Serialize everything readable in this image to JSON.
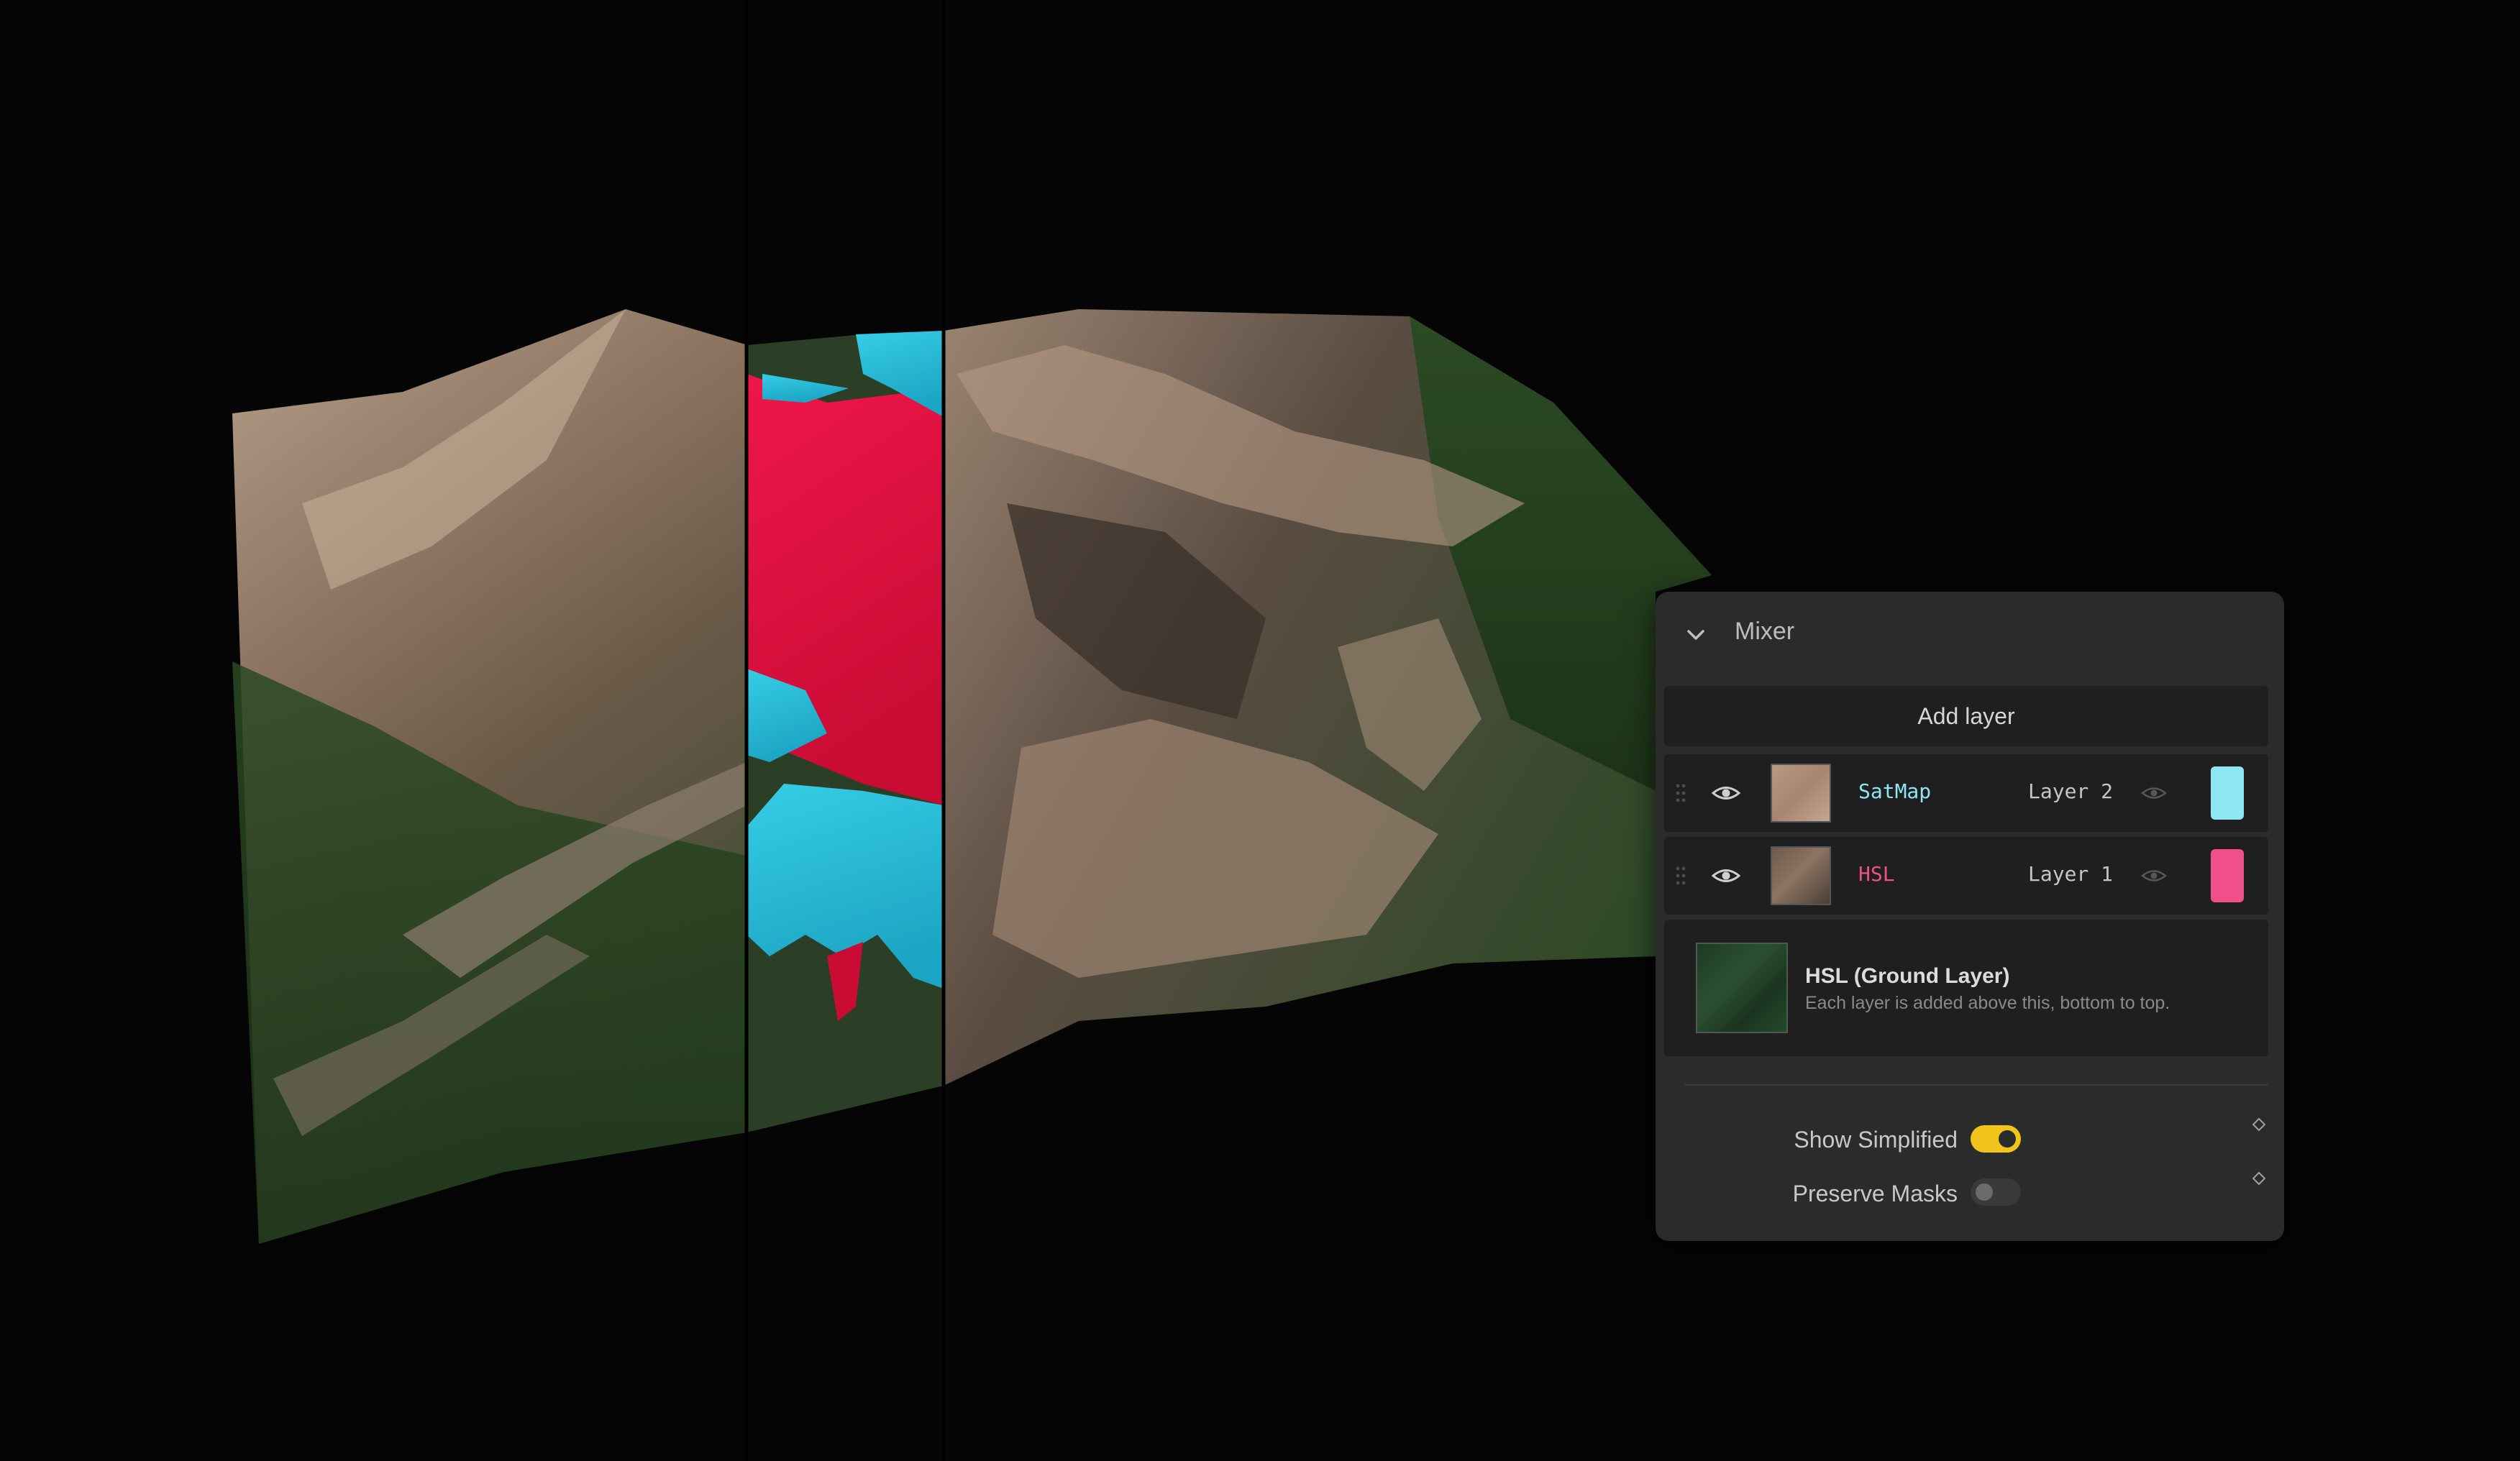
{
  "colors": {
    "background": "#050505",
    "panel": "#2b2b2b",
    "row": "#1f1f1f",
    "satmap_accent": "#8fe6f4",
    "hsl_accent": "#f0508a",
    "toggle_on": "#f0c419",
    "toggle_off": "#3a3a3a",
    "terrain_red": "#e8123f",
    "terrain_cyan": "#27c0dc"
  },
  "mixer": {
    "title": "Mixer",
    "collapse_icon": "chevron-down-icon",
    "add_layer_label": "Add layer",
    "layers": [
      {
        "name": "SatMap",
        "index_label": "Layer 2",
        "visible": true,
        "swatch": "#8fe6f4",
        "name_color": "#8fe6f4"
      },
      {
        "name": "HSL",
        "index_label": "Layer 1",
        "visible": true,
        "swatch": "#f0508a",
        "name_color": "#f0508a"
      }
    ],
    "ground": {
      "title": "HSL (Ground Layer)",
      "description": "Each layer is added above this, bottom to top."
    },
    "options": [
      {
        "label": "Show Simplified",
        "on": true
      },
      {
        "label": "Preserve Masks",
        "on": false
      }
    ]
  }
}
